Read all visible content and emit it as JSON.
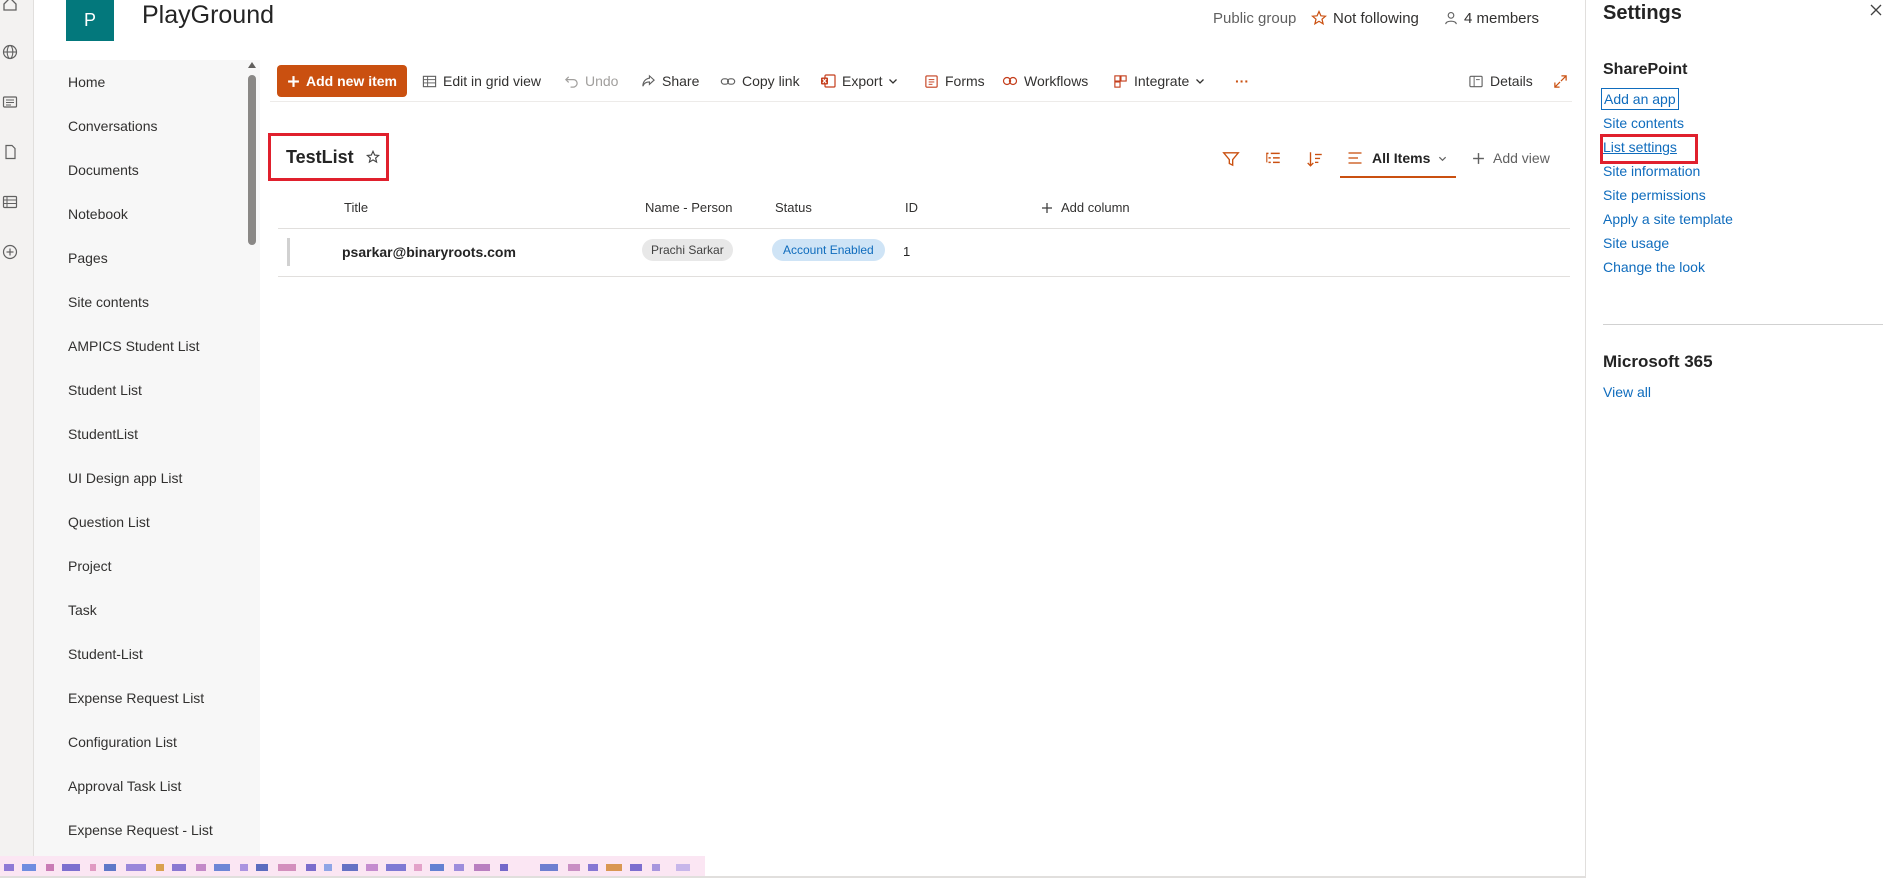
{
  "colors": {
    "accent": "#ca5010",
    "site_logo": "#03787c",
    "link": "#0f6cbd",
    "highlight": "#e0202d",
    "status_bg": "#cfe4f6"
  },
  "site": {
    "logo_letter": "P",
    "title": "PlayGround",
    "privacy": "Public group",
    "follow_label": "Not following",
    "members_label": "4 members"
  },
  "leftnav": {
    "items": [
      "Home",
      "Conversations",
      "Documents",
      "Notebook",
      "Pages",
      "Site contents",
      "AMPICS Student List",
      "Student List",
      "StudentList",
      "UI Design app List",
      "Question List",
      "Project",
      "Task",
      "Student-List",
      "Expense Request List",
      "Configuration List",
      "Approval Task List",
      "Expense Request - List"
    ]
  },
  "commandbar": {
    "new_item": "Add new item",
    "grid_view": "Edit in grid view",
    "undo": "Undo",
    "share": "Share",
    "copy_link": "Copy link",
    "export": "Export",
    "forms": "Forms",
    "workflows": "Workflows",
    "integrate": "Integrate",
    "more": "···",
    "details": "Details"
  },
  "list": {
    "title": "TestList",
    "view_name": "All Items",
    "add_view": "Add view",
    "columns": {
      "title": "Title",
      "person": "Name - Person",
      "status": "Status",
      "id": "ID",
      "add_column": "Add column"
    },
    "rows": [
      {
        "title": "psarkar@binaryroots.com",
        "person": "Prachi Sarkar",
        "status": "Account Enabled",
        "id": "1"
      }
    ]
  },
  "settings": {
    "title": "Settings",
    "sharepoint_heading": "SharePoint",
    "links": [
      "Add an app",
      "Site contents",
      "List settings",
      "Site information",
      "Site permissions",
      "Apply a site template",
      "Site usage",
      "Change the look"
    ],
    "m365_heading": "Microsoft 365",
    "view_all": "View all"
  }
}
